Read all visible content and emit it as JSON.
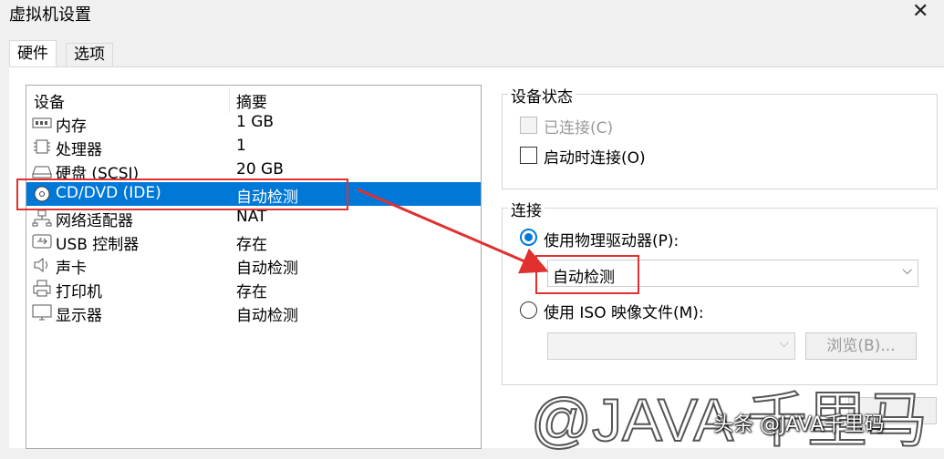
{
  "window": {
    "title": "虚拟机设置"
  },
  "tabs": [
    {
      "label": "硬件"
    },
    {
      "label": "选项"
    }
  ],
  "device_list": {
    "header": {
      "device": "设备",
      "summary": "摘要"
    },
    "rows": [
      {
        "device": "内存",
        "summary": "1 GB",
        "icon": "memory-icon"
      },
      {
        "device": "处理器",
        "summary": "1",
        "icon": "processor-icon"
      },
      {
        "device": "硬盘 (SCSI)",
        "summary": "20 GB",
        "icon": "hard-disk-icon"
      },
      {
        "device": "CD/DVD (IDE)",
        "summary": "自动检测",
        "icon": "cd-dvd-icon",
        "selected": true
      },
      {
        "device": "网络适配器",
        "summary": "NAT",
        "icon": "network-adapter-icon"
      },
      {
        "device": "USB 控制器",
        "summary": "存在",
        "icon": "usb-controller-icon"
      },
      {
        "device": "声卡",
        "summary": "自动检测",
        "icon": "sound-card-icon"
      },
      {
        "device": "打印机",
        "summary": "存在",
        "icon": "printer-icon"
      },
      {
        "device": "显示器",
        "summary": "自动检测",
        "icon": "display-icon"
      }
    ]
  },
  "device_status": {
    "label": "设备状态",
    "connected": {
      "label": "已连接(C)",
      "checked": false,
      "enabled": false
    },
    "connect_at_power_on": {
      "label": "启动时连接(O)",
      "checked": false,
      "enabled": true
    }
  },
  "connection": {
    "label": "连接",
    "physical_drive": {
      "label": "使用物理驱动器(P):",
      "selected": true,
      "value": "自动检测"
    },
    "iso_image": {
      "label": "使用 ISO 映像文件(M):",
      "selected": false,
      "value": ""
    },
    "browse_button": "浏览(B)..."
  },
  "watermark": {
    "text": "@JAVA 千里马",
    "caption": "头条 @JAVA千里码"
  },
  "colors": {
    "selection": "#0078d7",
    "annotation": "#e03030"
  }
}
